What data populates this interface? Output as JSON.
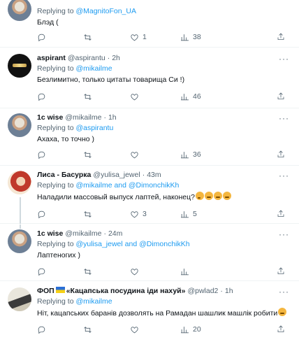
{
  "tweets": [
    {
      "reply_prefix": "Replying to ",
      "reply_to": "@MagnitoFon_UA",
      "text": "Блэд (",
      "replies": "",
      "retweets": "",
      "likes": "1",
      "views": "38"
    },
    {
      "name": "aspirant",
      "handle": "@aspirantu",
      "dot": "·",
      "time": "2h",
      "reply_prefix": "Replying to ",
      "reply_to": "@mikailme",
      "text": "Безлимитно, только цитаты товарища Си !)",
      "replies": "",
      "retweets": "",
      "likes": "",
      "views": "46",
      "more": "···"
    },
    {
      "name": "1c wise",
      "handle": "@mikailme",
      "dot": "·",
      "time": "1h",
      "reply_prefix": "Replying to ",
      "reply_to": "@aspirantu",
      "text": "Ахаха, то точно )",
      "replies": "",
      "retweets": "",
      "likes": "",
      "views": "36",
      "more": "···"
    },
    {
      "name": "Лиса - Басурка",
      "handle": "@yulisa_jewel",
      "dot": "·",
      "time": "43m",
      "reply_prefix": "Replying to ",
      "reply_to": "@mikailme and @DimonchikKh",
      "text": "Наладили массовый выпуск лаптей, наконец?",
      "emojis": [
        "thinking-face",
        "rofl",
        "rofl",
        "rofl"
      ],
      "replies": "",
      "retweets": "",
      "likes": "3",
      "views": "5",
      "more": "···"
    },
    {
      "name": "1c wise",
      "handle": "@mikailme",
      "dot": "·",
      "time": "24m",
      "reply_prefix": "Replying to ",
      "reply_to": "@yulisa_jewel and @DimonchikKh",
      "text": "Лаптеногих )",
      "replies": "",
      "retweets": "",
      "likes": "",
      "views": "",
      "more": "···"
    },
    {
      "name_prefix": "ФОП",
      "name_main": "«Кацапська посудина іди нахуй»",
      "handle": "@pwlad2",
      "dot": "·",
      "time": "1h",
      "reply_prefix": "Replying to ",
      "reply_to": "@mikailme",
      "text": "Ніт, кацапських баранів дозволять на Рамадан шашлик машлік робити",
      "emojis": [
        "tears-of-joy"
      ],
      "replies": "",
      "retweets": "",
      "likes": "",
      "views": "20",
      "more": "···"
    }
  ],
  "colors": {
    "link": "#1d9bf0",
    "secondary_text": "#536471",
    "divider": "#eff3f4",
    "thread_line": "#cfd9de"
  },
  "icons": {
    "reply": "reply-icon",
    "retweet": "retweet-icon",
    "like": "like-icon",
    "views": "views-icon",
    "bookmark": "bookmark-icon",
    "more": "more-icon"
  }
}
